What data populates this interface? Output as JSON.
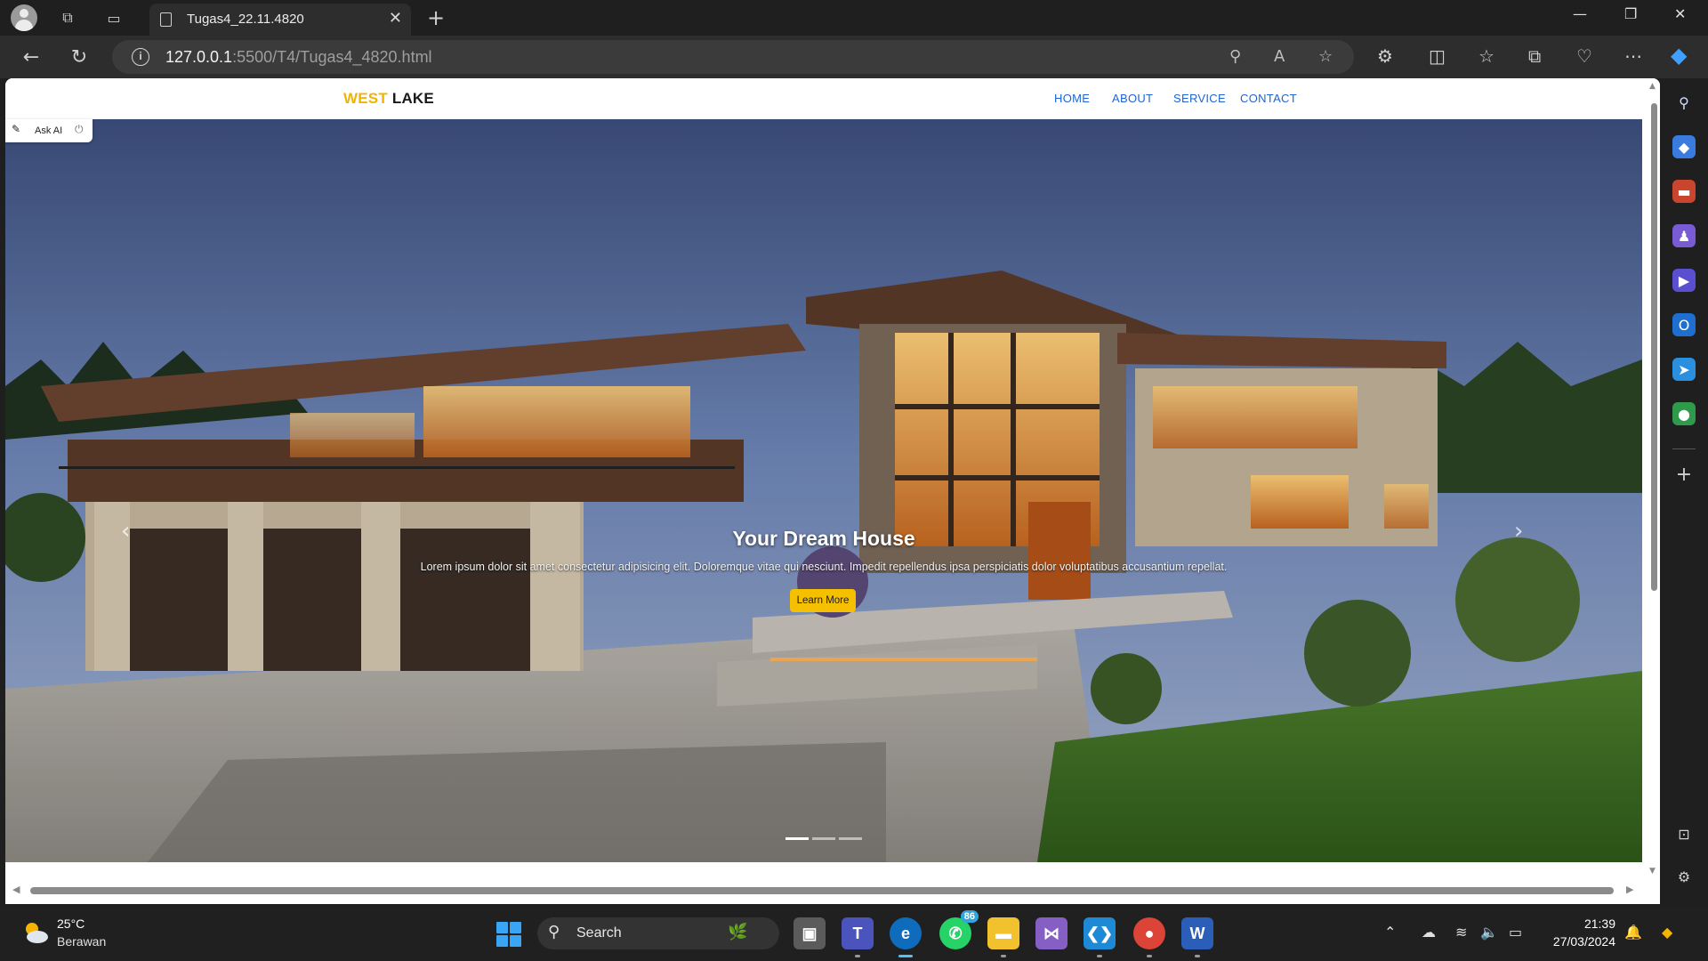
{
  "browser": {
    "tab_title": "Tugas4_22.11.4820",
    "url_host": "127.0.0.1",
    "url_path": ":5500/T4/Tugas4_4820.html"
  },
  "site": {
    "brand_part1": "WEST",
    "brand_part2": "LAKE",
    "nav": [
      "HOME",
      "ABOUT",
      "SERVICE",
      "CONTACT"
    ],
    "ask_ai_label": "Ask AI",
    "hero": {
      "title": "Your Dream House",
      "text": "Lorem ipsum dolor sit amet consectetur adipisicing elit. Doloremque vitae qui nesciunt. Impedit repellendus ipsa perspiciatis dolor voluptatibus accusantium repellat.",
      "button": "Learn More",
      "slide_count": 3,
      "active_slide": 1
    }
  },
  "taskbar": {
    "temperature": "25°C",
    "weather": "Berawan",
    "search_placeholder": "Search",
    "whatsapp_badge": "86",
    "time": "21:39",
    "date": "27/03/2024"
  },
  "colors": {
    "brand_accent": "#f2b400",
    "nav_link": "#1e64d6",
    "button": "#f5c000"
  }
}
